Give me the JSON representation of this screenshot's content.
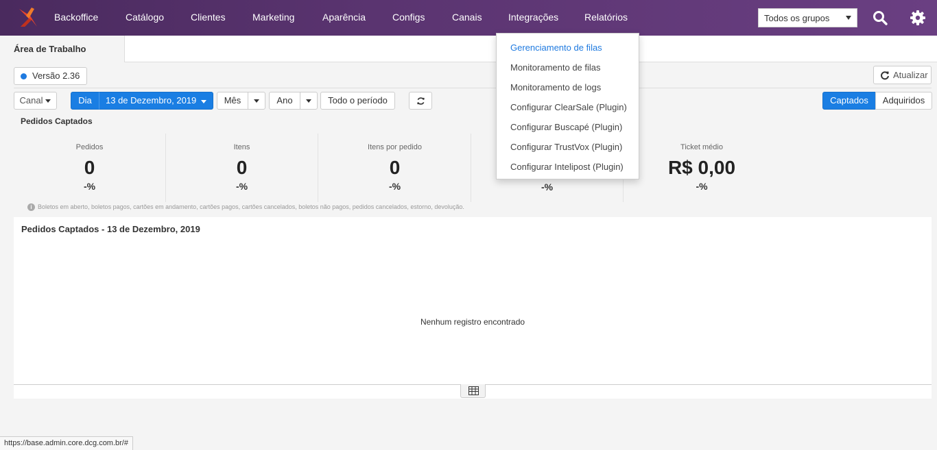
{
  "navbar": {
    "items": [
      "Backoffice",
      "Catálogo",
      "Clientes",
      "Marketing",
      "Aparência",
      "Configs",
      "Canais",
      "Integrações",
      "Relatórios"
    ],
    "group_select": "Todos os grupos",
    "brand_color": "#5a3470"
  },
  "tab": {
    "label": "Área de Trabalho"
  },
  "version": {
    "label": "Versão 2.36"
  },
  "refresh": {
    "label": "Atualizar"
  },
  "filters": {
    "canal": "Canal",
    "dia": "Dia",
    "date": "13 de Dezembro, 2019",
    "mes": "Mês",
    "ano": "Ano",
    "todo_periodo": "Todo o período",
    "captados": "Captados",
    "adquiridos": "Adquiridos",
    "accent": "#1a7ee3"
  },
  "summary": {
    "title": "Pedidos Captados",
    "metrics": [
      {
        "label": "Pedidos",
        "value": "0",
        "pct": "-%"
      },
      {
        "label": "Itens",
        "value": "0",
        "pct": "-%"
      },
      {
        "label": "Itens por pedido",
        "value": "0",
        "pct": "-%"
      },
      {
        "label": "",
        "value": "",
        "pct": "-%"
      },
      {
        "label": "Ticket médio",
        "value": "R$ 0,00",
        "pct": "-%"
      }
    ],
    "footnote": "Boletos em aberto, boletos pagos, cartões em andamento, cartões pagos, cartões cancelados, boletos não pagos, pedidos cancelados, estorno, devolução."
  },
  "panel": {
    "title": "Pedidos Captados - 13 de Dezembro, 2019",
    "empty": "Nenhum registro encontrado"
  },
  "dropdown": {
    "items": [
      "Gerenciamento de filas",
      "Monitoramento de filas",
      "Monitoramento de logs",
      "Configurar ClearSale (Plugin)",
      "Configurar Buscapé (Plugin)",
      "Configurar TrustVox (Plugin)",
      "Configurar Intelipost (Plugin)"
    ]
  },
  "status_url": "https://base.admin.core.dcg.com.br/#"
}
